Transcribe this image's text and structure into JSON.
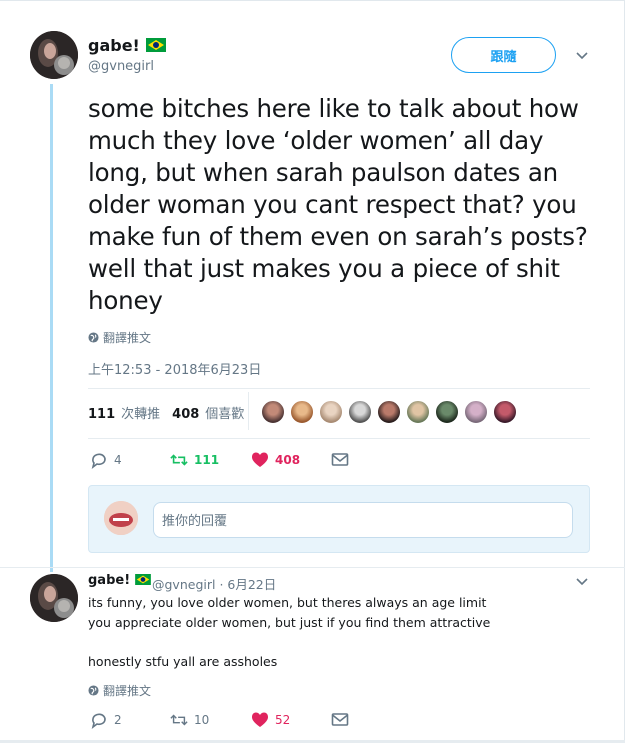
{
  "tweet": {
    "author": {
      "name": "gabe!",
      "handle": "@gvnegirl"
    },
    "follow_label": "跟隨",
    "text": "some bitches here like to talk about how much they love ‘older women’ all day long, but when sarah paulson dates an older woman you cant respect that? you make fun of them even on sarah’s posts? well that just makes you a piece of shit honey",
    "translate_label": "翻譯推文",
    "timestamp": "上午12:53 - 2018年6月23日",
    "retweets_count": "111",
    "retweets_label": "次轉推",
    "likes_count": "408",
    "likes_label": "個喜歡",
    "actions": {
      "replies": "4",
      "retweets": "111",
      "likes": "408"
    },
    "reply_placeholder": "推你的回覆"
  },
  "reply_tweet": {
    "author": {
      "name": "gabe!",
      "handle": "@gvnegirl",
      "date": "· 6月22日"
    },
    "text": "its funny, you love older women, but theres always an age limit\nyou appreciate older women, but just if you find them attractive\n\nhonestly stfu yall are assholes",
    "translate_label": "翻譯推文",
    "actions": {
      "replies": "2",
      "retweets": "10",
      "likes": "52"
    }
  },
  "colors": {
    "accent": "#1da1f2",
    "retweet_green": "#17bf63",
    "like_red": "#e0245e",
    "muted": "#657786",
    "thread_line": "#aadbf5"
  },
  "likers": [
    "liker-1",
    "liker-2",
    "liker-3",
    "liker-4",
    "liker-5",
    "liker-6",
    "liker-7",
    "liker-8",
    "liker-9"
  ]
}
